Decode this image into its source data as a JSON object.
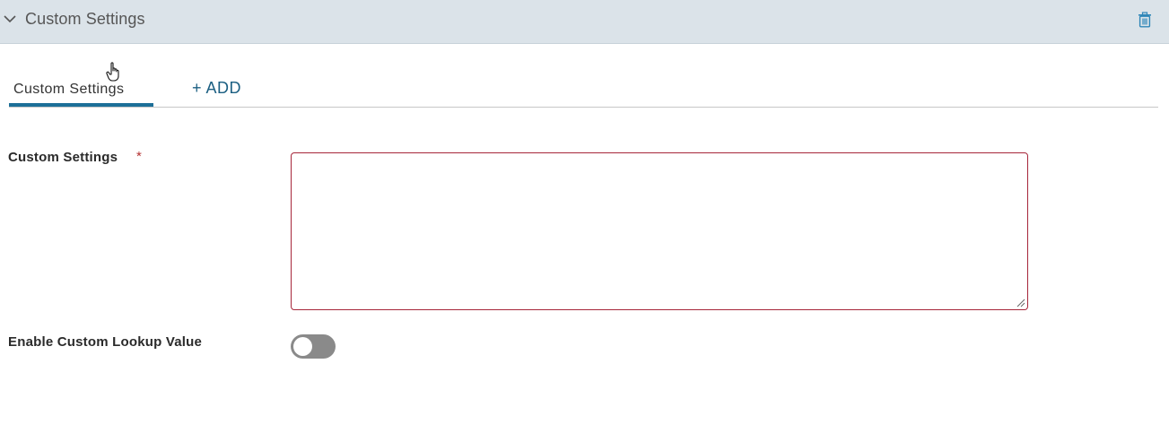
{
  "header": {
    "title": "Custom Settings",
    "collapse_icon": "chevron-down-icon",
    "delete_icon": "trash-icon"
  },
  "tabs": {
    "items": [
      {
        "label": "Custom Settings",
        "active": true
      }
    ],
    "add_label": "+ ADD"
  },
  "form": {
    "custom_settings": {
      "label": "Custom Settings",
      "required_marker": "*",
      "value": "",
      "resize_icon": "resize-grip-icon"
    },
    "enable_lookup": {
      "label": "Enable Custom Lookup Value",
      "enabled": false
    }
  },
  "colors": {
    "header_bg": "#dbe3e9",
    "accent": "#1d6f98",
    "error_border": "#a6263a",
    "toggle_off": "#8a8a8a"
  }
}
